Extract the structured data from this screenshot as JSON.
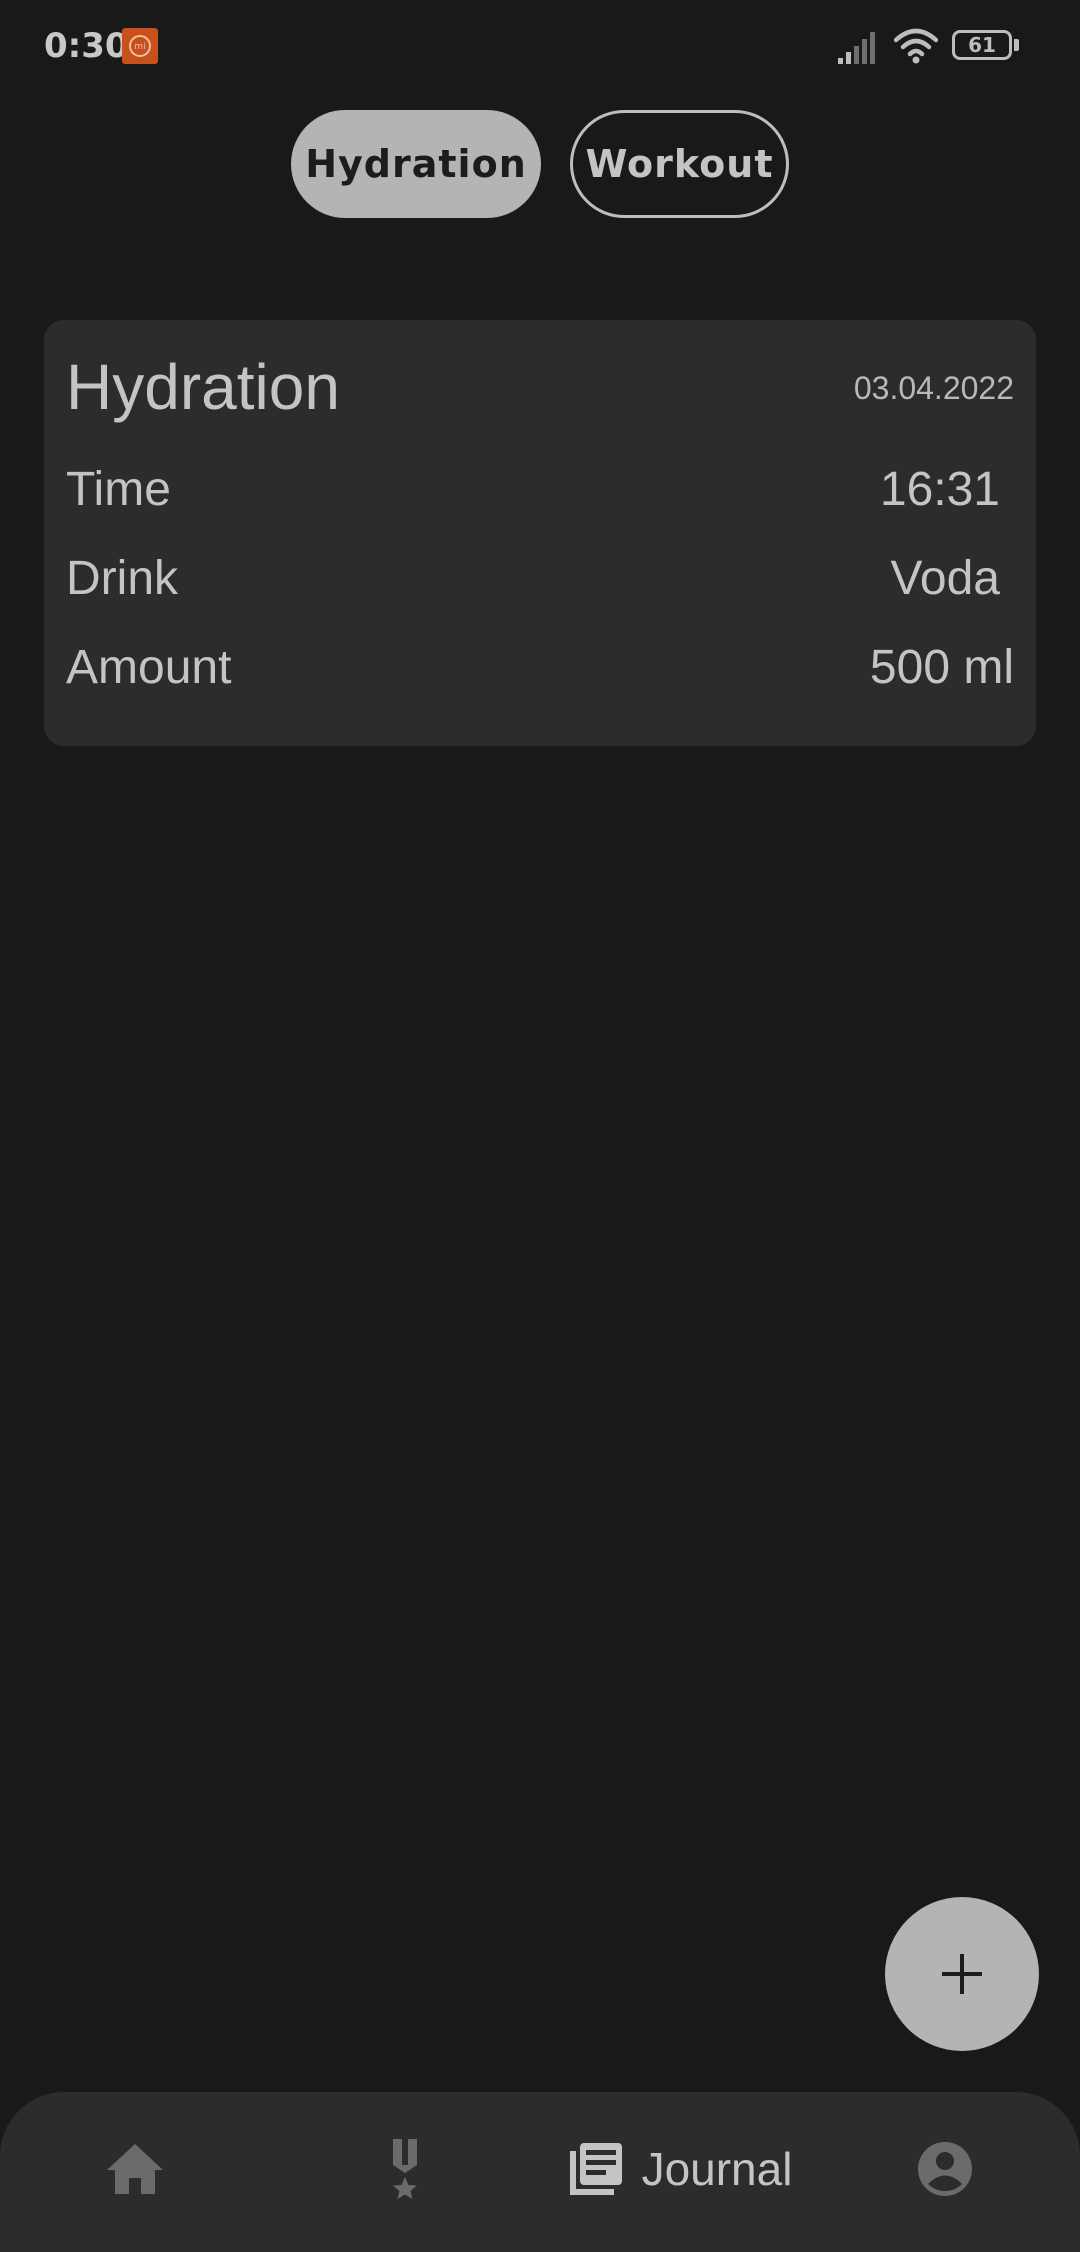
{
  "status_bar": {
    "time": "0:30",
    "battery": "61",
    "icons": [
      "app-notification-icon",
      "signal-icon",
      "wifi-icon",
      "battery-icon"
    ]
  },
  "tabs": [
    {
      "label": "Hydration",
      "selected": true
    },
    {
      "label": "Workout",
      "selected": false
    }
  ],
  "entry": {
    "title": "Hydration",
    "date": "03.04.2022",
    "rows": [
      {
        "label": "Time",
        "value": "16:31"
      },
      {
        "label": "Drink",
        "value": "Voda"
      },
      {
        "label": "Amount",
        "value": "500 ml"
      }
    ]
  },
  "fab": {
    "icon": "plus-icon"
  },
  "bottom_nav": {
    "items": [
      {
        "icon": "home-icon",
        "label": "",
        "selected": false
      },
      {
        "icon": "medal-icon",
        "label": "",
        "selected": false
      },
      {
        "icon": "journal-icon",
        "label": "Journal",
        "selected": true
      },
      {
        "icon": "account-icon",
        "label": "",
        "selected": false
      }
    ]
  },
  "colors": {
    "background": "#191919",
    "surface": "#2c2c2c",
    "selected_tab": "#b4b4b4",
    "text": "#c4c4c4",
    "icon_inactive": "#6b6b6b",
    "notification": "#c8501a"
  }
}
